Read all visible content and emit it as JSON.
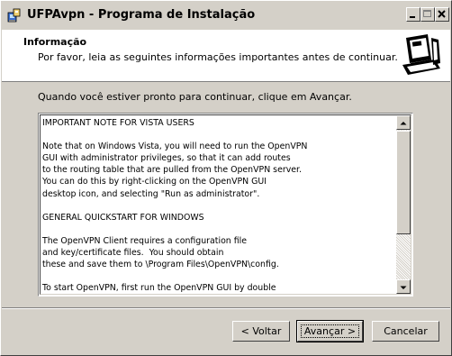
{
  "window": {
    "title": "UFPAvpn - Programa de Instalação",
    "minimize_icon": "minimize-icon",
    "maximize_icon": "maximize-icon",
    "close_icon": "close-icon"
  },
  "header": {
    "title": "Informação",
    "subtitle": "Por favor, leia as seguintes informações importantes antes de continuar.",
    "image_icon": "computer-install-icon"
  },
  "content": {
    "instruction": "Quando você estiver pronto para continuar, clique em Avançar.",
    "info_text": "IMPORTANT NOTE FOR VISTA USERS\n\nNote that on Windows Vista, you will need to run the OpenVPN\nGUI with administrator privileges, so that it can add routes\nto the routing table that are pulled from the OpenVPN server.\nYou can do this by right-clicking on the OpenVPN GUI\ndesktop icon, and selecting \"Run as administrator\".\n\nGENERAL QUICKSTART FOR WINDOWS\n\nThe OpenVPN Client requires a configuration file\nand key/certificate files.  You should obtain\nthese and save them to \\Program Files\\OpenVPN\\config.\n\nTo start OpenVPN, first run the OpenVPN GUI by double\nclicking on the desktop icon or start menu icon."
  },
  "buttons": {
    "back": "< Voltar",
    "next": "Avançar >",
    "cancel": "Cancelar"
  },
  "colors": {
    "face": "#d4d0c8",
    "shadow": "#808080",
    "dark_shadow": "#404040",
    "highlight": "#ffffff"
  }
}
